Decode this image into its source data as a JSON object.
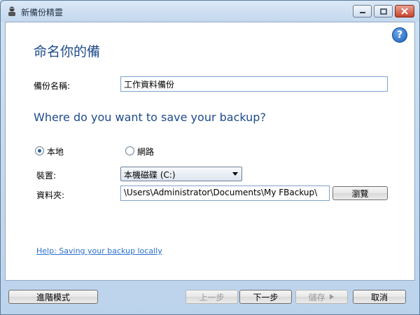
{
  "window": {
    "title": "新備份精靈",
    "app_icon": "wizard-icon",
    "controls": {
      "minimize": "minimize-icon",
      "maximize": "maximize-icon",
      "close": "close-icon"
    }
  },
  "help": {
    "icon": "help-icon",
    "glyph": "?"
  },
  "page": {
    "heading": "命名你的備",
    "backup_name_label": "備份名稱:",
    "backup_name_value": "工作資料備份",
    "subheading": "Where do you want to save your backup?"
  },
  "location": {
    "local_label": "本地",
    "network_label": "網路",
    "selected": "local"
  },
  "device": {
    "label": "裝置:",
    "value": "本機磁碟 (C:)"
  },
  "folder": {
    "label": "資料夾:",
    "value": "\\Users\\Administrator\\Documents\\My FBackup\\",
    "browse_label": "瀏覽"
  },
  "help_link": "Help: Saving your backup locally",
  "footer": {
    "advanced_label": "進階模式",
    "back_label": "上一步",
    "next_label": "下一步",
    "save_label": "儲存",
    "cancel_label": "取消"
  },
  "colors": {
    "heading": "#1e4b8a",
    "link": "#2b6fd1",
    "frame": "#cfe1f3"
  }
}
